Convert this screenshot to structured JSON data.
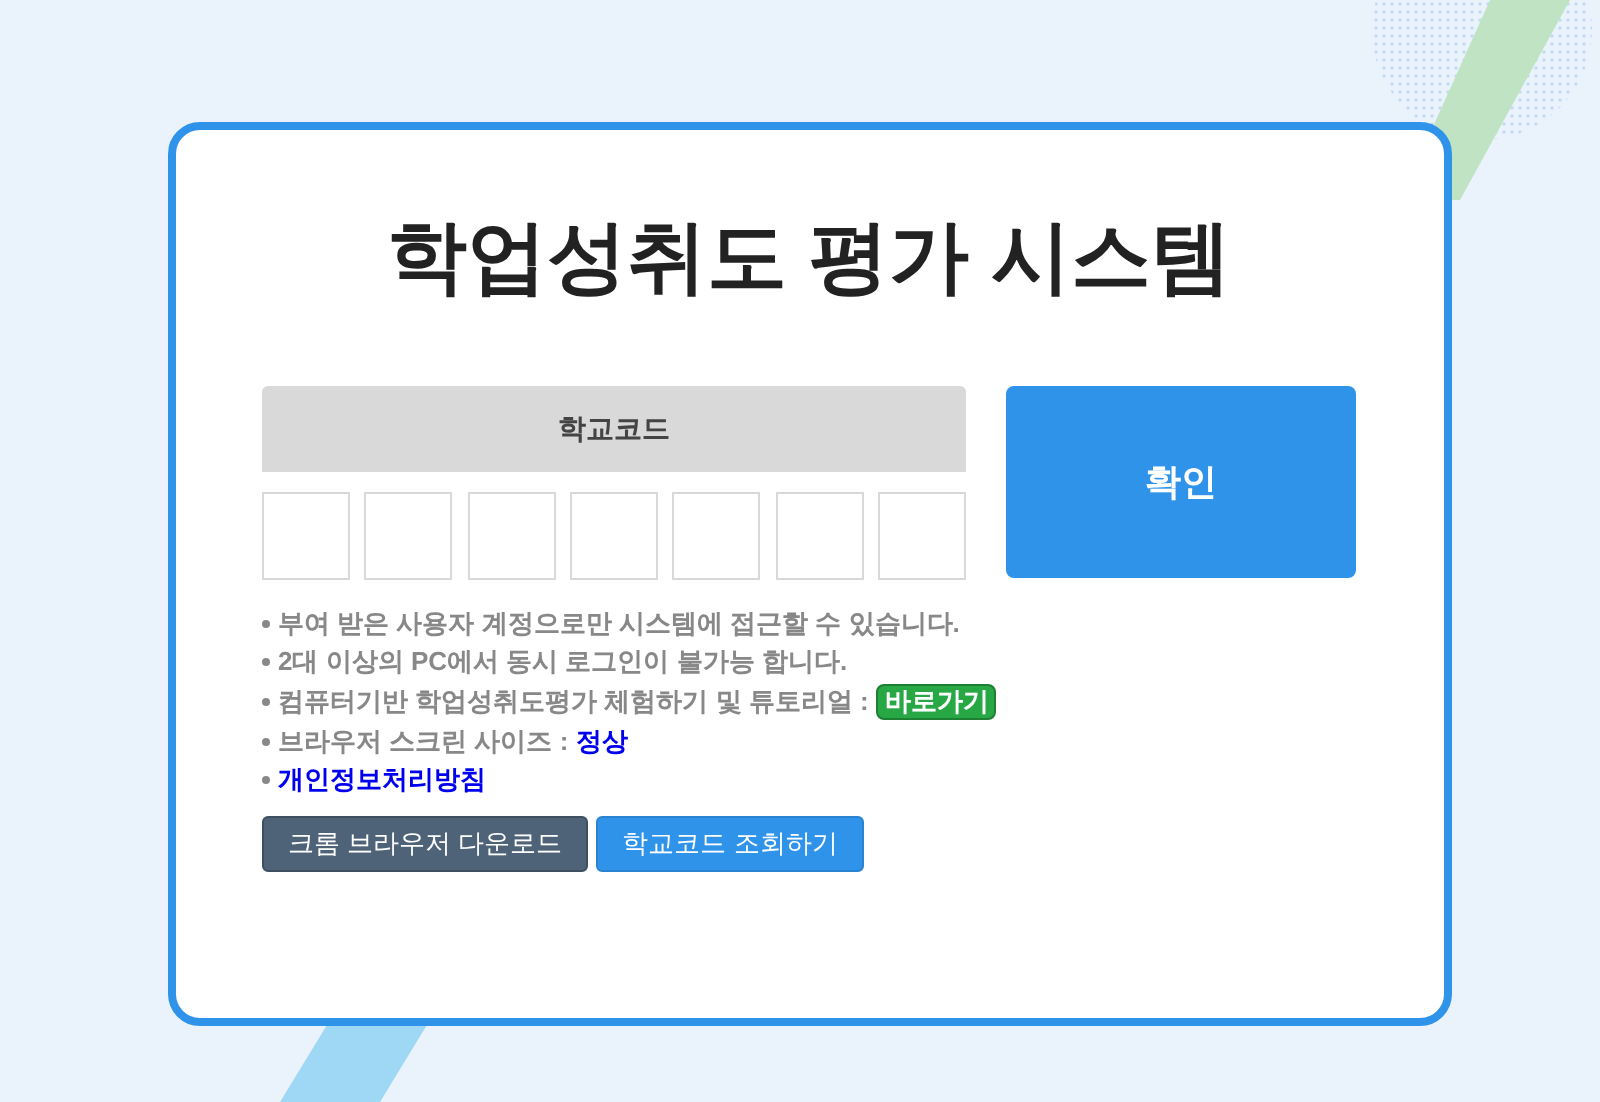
{
  "title": "학업성취도 평가 시스템",
  "school_code": {
    "label": "학교코드"
  },
  "confirm_button": "확인",
  "notes": [
    {
      "kind": "plain",
      "text": "부여 받은 사용자 계정으로만 시스템에 접근할 수 있습니다."
    },
    {
      "kind": "plain",
      "text": "2대 이상의 PC에서 동시 로그인이 불가능 합니다."
    },
    {
      "kind": "badge",
      "text": "컴퓨터기반 학업성취도평가 체험하기 및 튜토리얼 :",
      "badge": "바로가기"
    },
    {
      "kind": "status",
      "text": "브라우저 스크린 사이즈 :",
      "value": "정상"
    },
    {
      "kind": "link",
      "text": "개인정보처리방침"
    }
  ],
  "buttons": [
    {
      "kind": "dark",
      "label": "크롬 브라우저 다운로드"
    },
    {
      "kind": "blue",
      "label": "학교코드 조회하기"
    }
  ]
}
